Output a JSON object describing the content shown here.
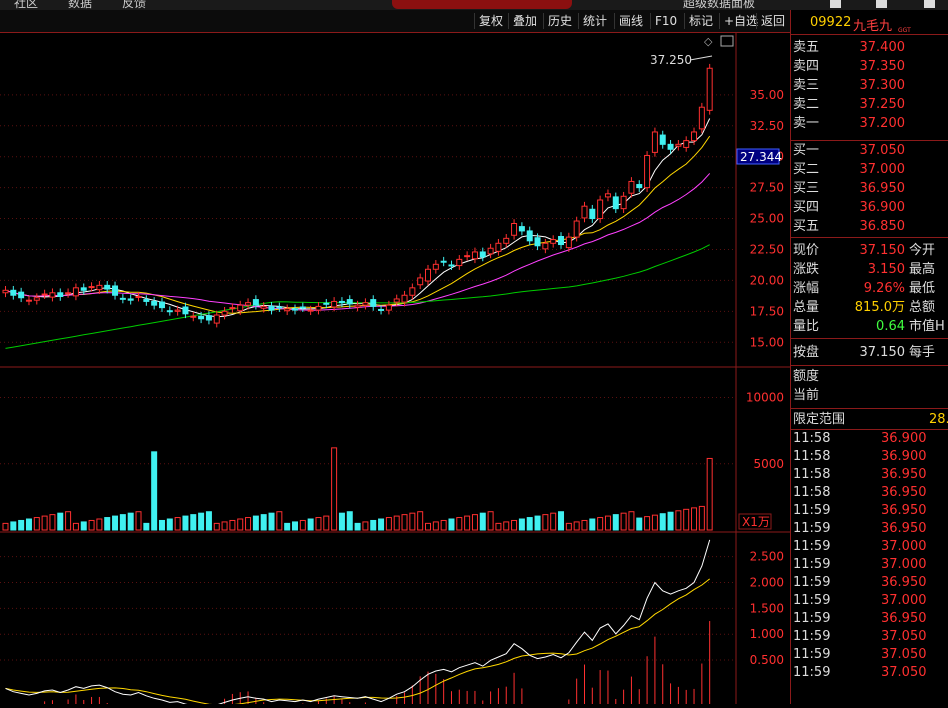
{
  "top_tabs": [
    "社区",
    "数据",
    "反馈"
  ],
  "top_right": "超级数据面板",
  "toolbar": {
    "items": [
      "复权",
      "叠加",
      "历史",
      "统计",
      "画线",
      "F10",
      "标记",
      "+自选",
      "返回"
    ]
  },
  "stock": {
    "code": "09922",
    "name": "九毛九",
    "tag": "GGT"
  },
  "orderbook": {
    "asks": [
      {
        "label": "卖五",
        "price": "37.400"
      },
      {
        "label": "卖四",
        "price": "37.350"
      },
      {
        "label": "卖三",
        "price": "37.300"
      },
      {
        "label": "卖二",
        "price": "37.250"
      },
      {
        "label": "卖一",
        "price": "37.200"
      }
    ],
    "bids": [
      {
        "label": "买一",
        "price": "37.050"
      },
      {
        "label": "买二",
        "price": "37.000"
      },
      {
        "label": "买三",
        "price": "36.950"
      },
      {
        "label": "买四",
        "price": "36.900"
      },
      {
        "label": "买五",
        "price": "36.850"
      }
    ]
  },
  "quote": {
    "price_label": "现价",
    "price": "37.150",
    "open_label": "今开",
    "change_label": "涨跌",
    "change": "3.150",
    "high_label": "最高",
    "pct_label": "涨幅",
    "pct": "9.26%",
    "low_label": "最低",
    "vol_label": "总量",
    "vol": "815.0万",
    "amount_label": "总额",
    "ratio_label": "量比",
    "ratio": "0.64",
    "mktcap_label": "市值H",
    "bid_label": "按盘",
    "bid": "37.150",
    "lot_label": "每手",
    "quota_label": "额度",
    "current_label": "当前",
    "limit_label": "限定范围",
    "limit": "28."
  },
  "ticks": [
    {
      "t": "11:58",
      "p": "36.900"
    },
    {
      "t": "11:58",
      "p": "36.900"
    },
    {
      "t": "11:58",
      "p": "36.950"
    },
    {
      "t": "11:58",
      "p": "36.950"
    },
    {
      "t": "11:59",
      "p": "36.950"
    },
    {
      "t": "11:59",
      "p": "36.950"
    },
    {
      "t": "11:59",
      "p": "37.000"
    },
    {
      "t": "11:59",
      "p": "37.000"
    },
    {
      "t": "11:59",
      "p": "36.950"
    },
    {
      "t": "11:59",
      "p": "37.000"
    },
    {
      "t": "11:59",
      "p": "36.950"
    },
    {
      "t": "11:59",
      "p": "37.050"
    },
    {
      "t": "11:59",
      "p": "37.050"
    },
    {
      "t": "11:59",
      "p": "37.050"
    }
  ],
  "chart_data": [
    {
      "type": "candlestick",
      "title": "",
      "yticks": [
        "35.00",
        "32.50",
        "30.00",
        "27.50",
        "25.00",
        "22.50",
        "20.00",
        "17.50",
        "15.00"
      ],
      "ylim": [
        13,
        40
      ],
      "max_label": "37.250",
      "cursor_label": "27.344",
      "closes": [
        19.2,
        18.8,
        18.6,
        18.4,
        18.6,
        18.9,
        19.0,
        18.7,
        19.0,
        19.4,
        19.2,
        19.5,
        19.6,
        19.3,
        18.8,
        18.5,
        18.4,
        18.7,
        18.3,
        18.0,
        17.8,
        17.5,
        17.6,
        17.3,
        17.1,
        16.9,
        16.8,
        17.2,
        17.5,
        17.8,
        18.0,
        18.2,
        18.0,
        17.9,
        17.6,
        17.8,
        17.7,
        17.6,
        17.8,
        17.6,
        17.9,
        18.1,
        18.3,
        18.2,
        18.1,
        18.0,
        18.2,
        17.9,
        17.6,
        18.0,
        18.5,
        18.8,
        19.4,
        20.2,
        20.9,
        21.3,
        21.5,
        21.2,
        21.7,
        22.0,
        22.3,
        21.9,
        22.6,
        23.0,
        23.4,
        24.6,
        24.0,
        23.2,
        22.8,
        23.0,
        23.3,
        22.9,
        23.5,
        24.8,
        26.0,
        25.0,
        26.5,
        27.0,
        25.8,
        26.8,
        28.0,
        27.5,
        30.1,
        32.0,
        31.0,
        30.6,
        31.0,
        31.3,
        32.0,
        34.0,
        37.15
      ],
      "ma_series": [
        {
          "color": "#ffffff",
          "name": ""
        },
        {
          "color": "#ffd700",
          "name": ""
        },
        {
          "color": "#ff40ff",
          "name": ""
        },
        {
          "color": "#00cc00",
          "name": ""
        }
      ]
    },
    {
      "type": "bar",
      "title": "",
      "unit_label": "X1万",
      "yticks": [
        "10000",
        "5000"
      ],
      "ylim": [
        0,
        12000
      ],
      "spikes": [
        {
          "i": 19,
          "v": 5900
        },
        {
          "i": 42,
          "v": 6200
        },
        {
          "i": 90,
          "v": 5400
        }
      ]
    },
    {
      "type": "line",
      "title": "",
      "yticks": [
        "2.500",
        "2.000",
        "1.500",
        "1.000",
        "0.500"
      ],
      "ylim": [
        0,
        3
      ]
    }
  ]
}
